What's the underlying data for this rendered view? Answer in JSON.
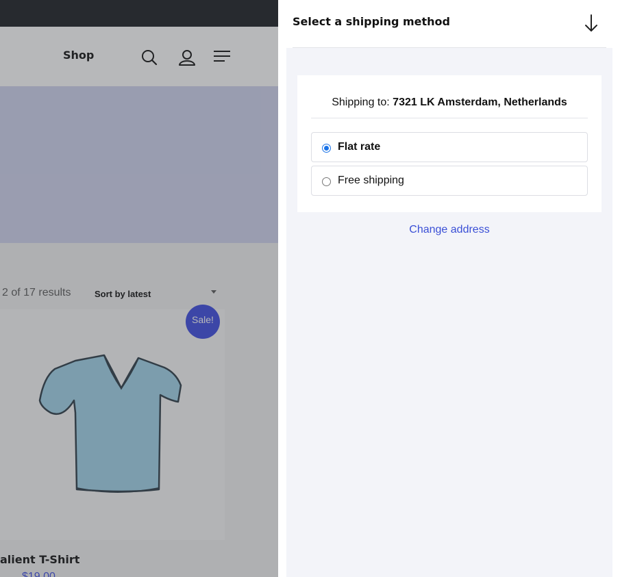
{
  "background_page": {
    "nav": {
      "shop_label": "Shop"
    },
    "results_text": "2 of 17 results",
    "sort_label": "Sort by latest",
    "product": {
      "sale_badge": "Sale!",
      "name": "alient T-Shirt",
      "price": "$19.00"
    },
    "icons": [
      "search-icon",
      "account-icon",
      "menu-icon"
    ]
  },
  "shipping_panel": {
    "title": "Select a shipping method",
    "close_icon": "arrow-down-icon",
    "shipping_to_label": "Shipping to:",
    "shipping_to_address": "7321 LK Amsterdam, Netherlands",
    "options": [
      {
        "label": "Flat rate",
        "selected": true
      },
      {
        "label": "Free shipping",
        "selected": false
      }
    ],
    "change_address_label": "Change address"
  },
  "colors": {
    "accent": "#4a58e3",
    "link": "#3a4fd6",
    "radio_selected": "#1a73e8",
    "panel_body_bg": "#f3f4f9"
  }
}
